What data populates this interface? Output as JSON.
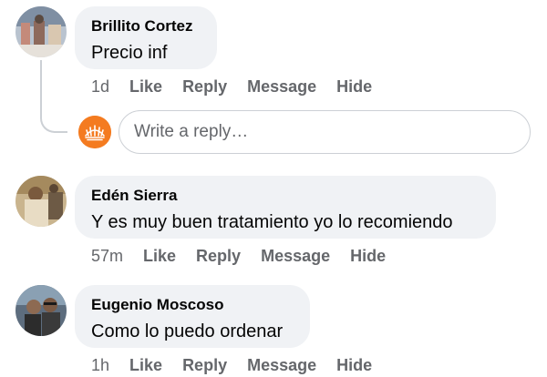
{
  "comments": [
    {
      "author": "Brillito Cortez",
      "text": "Precio inf",
      "time": "1d",
      "actions": [
        "Like",
        "Reply",
        "Message",
        "Hide"
      ],
      "avatar_icon": "user-avatar-photo"
    },
    {
      "author": "Edén Sierra",
      "text": "Y es muy buen tratamiento yo lo recomiendo",
      "time": "57m",
      "actions": [
        "Like",
        "Reply",
        "Message",
        "Hide"
      ],
      "avatar_icon": "user-avatar-photo"
    },
    {
      "author": "Eugenio Moscoso",
      "text": "Como lo puedo ordenar",
      "time": "1h",
      "actions": [
        "Like",
        "Reply",
        "Message",
        "Hide"
      ],
      "avatar_icon": "user-avatar-photo"
    }
  ],
  "reply_box": {
    "placeholder": "Write a reply…",
    "value": "",
    "avatar_icon": "page-logo-icon",
    "avatar_color": "#f47b20"
  },
  "colors": {
    "bubble": "#f0f2f5",
    "meta_text": "#65676b",
    "primary_text": "#050505",
    "thread_line": "#ccd0d5"
  }
}
